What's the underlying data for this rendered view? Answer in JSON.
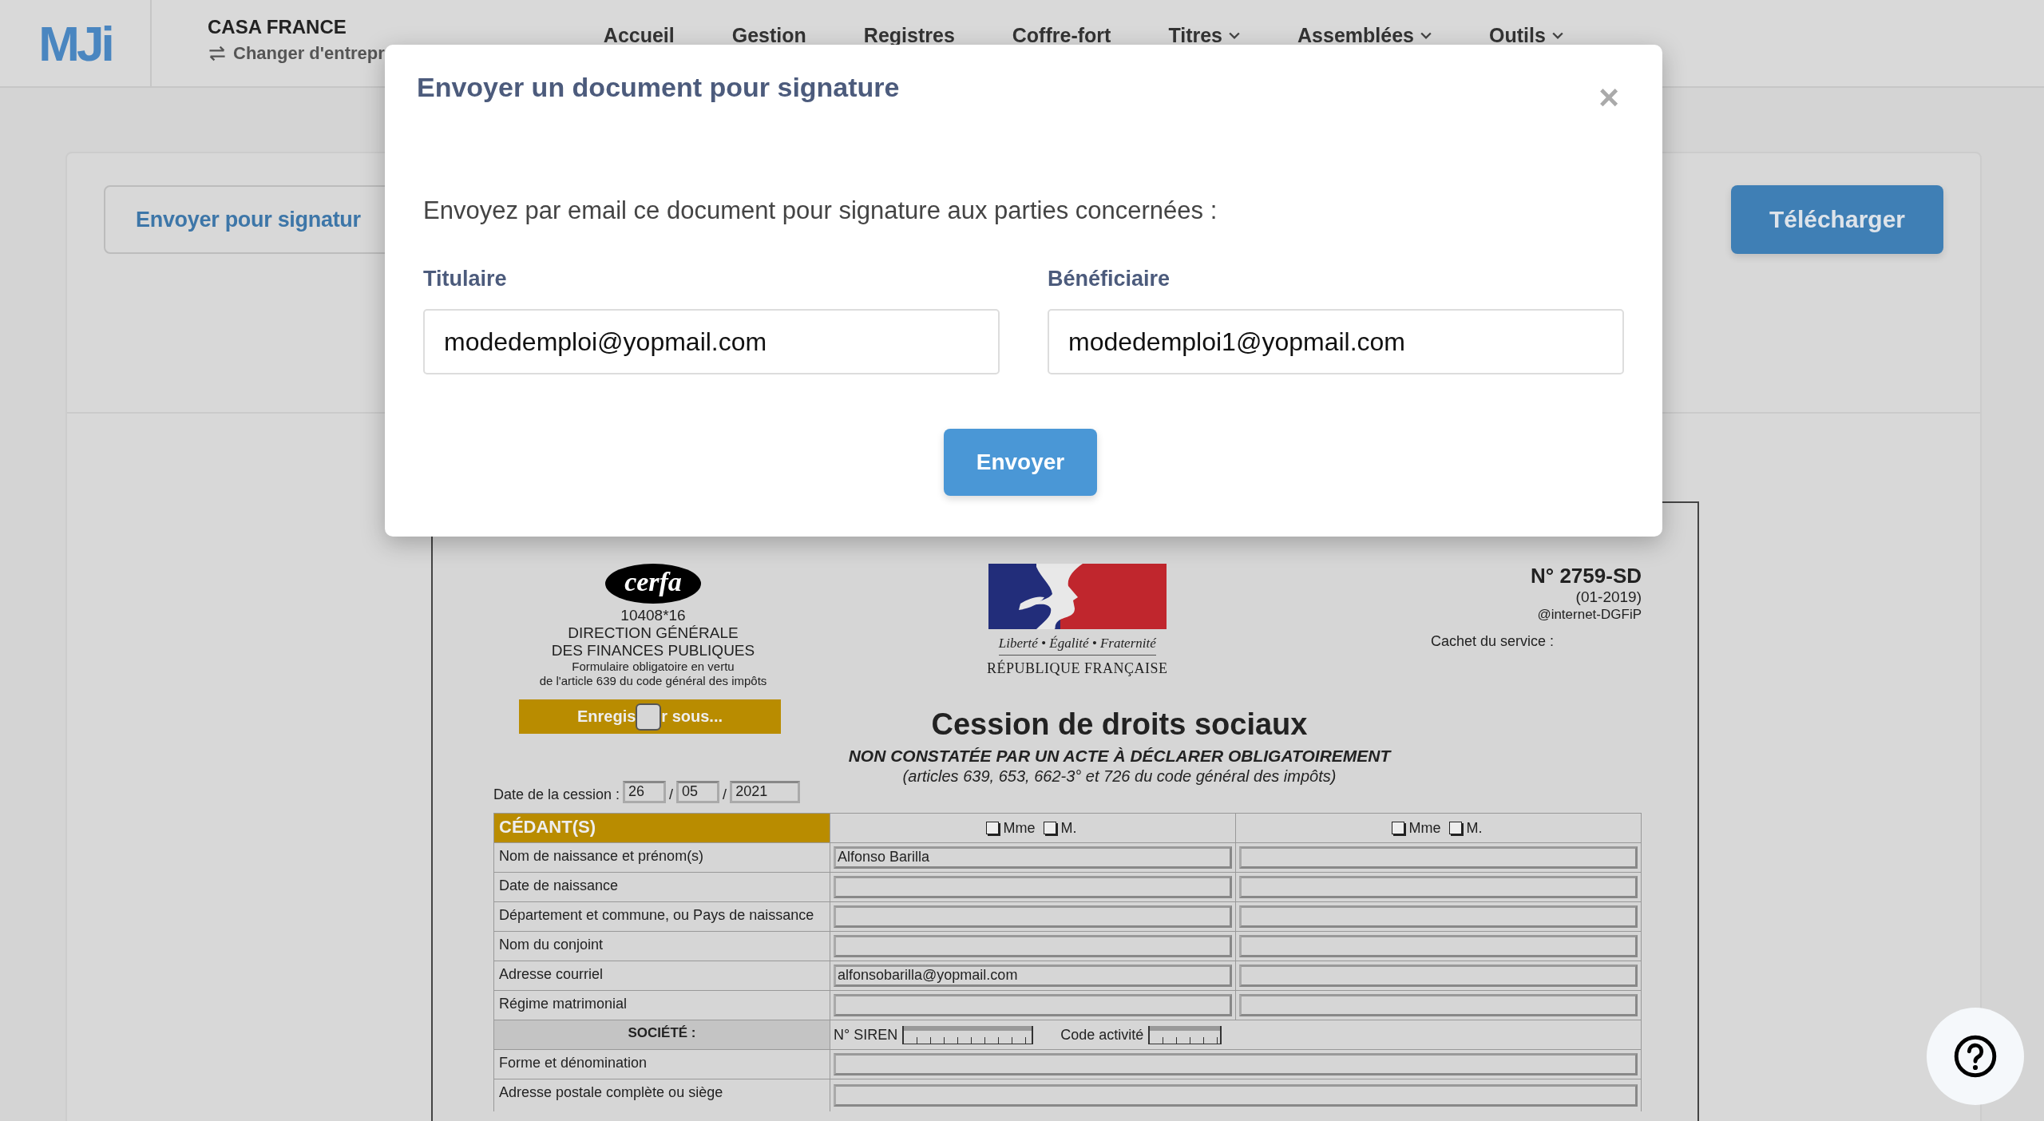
{
  "header": {
    "logo": "MJi",
    "company": "CASA FRANCE",
    "switch_link": "Changer d'entrepr",
    "nav": [
      {
        "label": "Accueil",
        "dropdown": false
      },
      {
        "label": "Gestion",
        "dropdown": false
      },
      {
        "label": "Registres",
        "dropdown": false
      },
      {
        "label": "Coffre-fort",
        "dropdown": false
      },
      {
        "label": "Titres",
        "dropdown": true
      },
      {
        "label": "Assemblées",
        "dropdown": true
      },
      {
        "label": "Outils",
        "dropdown": true
      }
    ]
  },
  "toolbar": {
    "send_button": "Envoyer pour signatur",
    "download_button": "Télécharger"
  },
  "document": {
    "cerfa_logo": "cerfa",
    "cerfa_number": "10408*16",
    "issuer_lines": [
      "DIRECTION GÉNÉRALE",
      "DES FINANCES PUBLIQUES"
    ],
    "legal_lines": [
      "Formulaire obligatoire en vertu",
      "de l'article 639 du code général des impôts"
    ],
    "republic": {
      "motto": "Liberté • Égalité • Fraternité",
      "name": "RÉPUBLIQUE FRANÇAISE"
    },
    "form_number": "N° 2759-SD",
    "form_version": "(01-2019)",
    "form_source": "@internet-DGFiP",
    "stamp_label": "Cachet du service :",
    "save_button": {
      "text_before": "Enregis",
      "text_after": "r sous..."
    },
    "title": "Cession de droits sociaux",
    "subtitle": "NON CONSTATÉE PAR UN ACTE À DÉCLARER OBLIGATOIREMENT",
    "reference": "(articles 639, 653, 662-3° et 726 du code général des impôts)",
    "date": {
      "label": "Date de la cession :",
      "day": "26",
      "separators": [
        "/",
        "/"
      ],
      "month": "05",
      "year": "2021"
    },
    "table": {
      "header_label": "CÉDANT(S)",
      "parties": [
        {
          "options": [
            {
              "label": "Mme",
              "checked": false
            },
            {
              "label": "M.",
              "checked": false
            }
          ]
        },
        {
          "options": [
            {
              "label": "Mme",
              "checked": false
            },
            {
              "label": "M.",
              "checked": false
            }
          ]
        }
      ],
      "rows": [
        {
          "label": "Nom de naissance et prénom(s)",
          "values": [
            "Alfonso Barilla"
          ]
        },
        {
          "label": "Date de naissance"
        },
        {
          "label": "Département et commune, ou Pays de naissance"
        },
        {
          "label": "Nom du conjoint"
        },
        {
          "label": "Adresse courriel",
          "values": [
            "alfonsobarilla@yopmail.com"
          ]
        },
        {
          "label": "Régime matrimonial"
        }
      ],
      "company_row": {
        "label": "SOCIÉTÉ :",
        "siren_label": "N° SIREN",
        "activity_label": "Code activité"
      },
      "extra_rows": [
        {
          "label": "Forme et dénomination"
        },
        {
          "label": "Adresse postale complète ou siège"
        }
      ]
    }
  },
  "modal": {
    "title": "Envoyer un document pour signature",
    "close": "×",
    "intro": "Envoyez par email ce document pour signature aux parties concernées :",
    "fields": [
      {
        "label": "Titulaire",
        "value": "modedemploi@yopmail.com"
      },
      {
        "label": "Bénéficiaire",
        "value": "modedemploi1@yopmail.com"
      }
    ],
    "submit": "Envoyer"
  }
}
